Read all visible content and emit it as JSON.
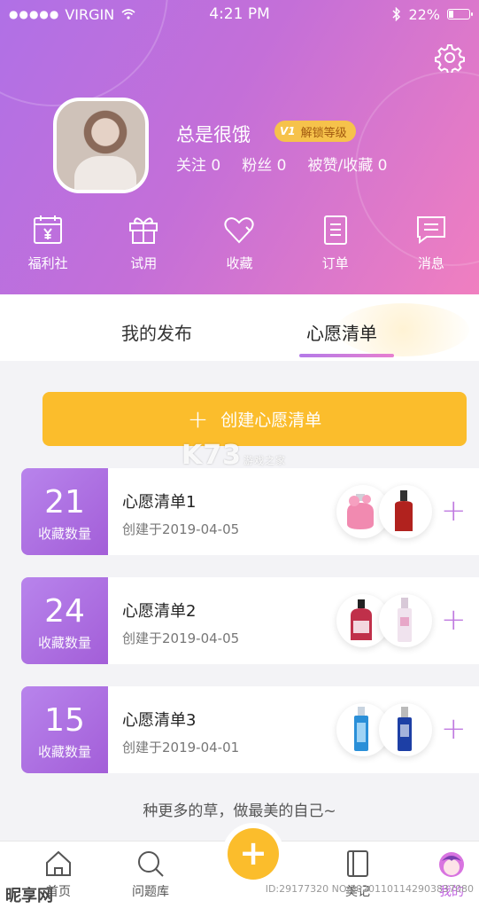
{
  "status": {
    "carrier": "VIRGIN",
    "signal": "●●●●●",
    "time": "4:21 PM",
    "battery": "22%"
  },
  "profile": {
    "name": "总是很饿",
    "level_badge": "V1",
    "unlock": "解锁等级",
    "following": "关注 0",
    "fans": "粉丝 0",
    "likes": "被赞/收藏 0"
  },
  "quick_links": [
    {
      "label": "福利社",
      "icon": "calendar-yen-icon"
    },
    {
      "label": "试用",
      "icon": "gift-icon"
    },
    {
      "label": "收藏",
      "icon": "heart-icon"
    },
    {
      "label": "订单",
      "icon": "clipboard-icon"
    },
    {
      "label": "消息",
      "icon": "chat-icon"
    }
  ],
  "tabs": [
    {
      "label": "我的发布"
    },
    {
      "label": "心愿清单",
      "active": true
    }
  ],
  "create_button": {
    "plus": "+",
    "label": "创建心愿清单"
  },
  "watermark": {
    "brand": "K73",
    "sub": "游戏之家"
  },
  "wishlists": [
    {
      "count": "21",
      "count_label": "收藏数量",
      "title": "心愿清单1",
      "date": "创建于2019-04-05"
    },
    {
      "count": "24",
      "count_label": "收藏数量",
      "title": "心愿清单2",
      "date": "创建于2019-04-05"
    },
    {
      "count": "15",
      "count_label": "收藏数量",
      "title": "心愿清单3",
      "date": "创建于2019-04-01"
    }
  ],
  "add_symbol": "+",
  "tagline": "种更多的草，做最美的自己~",
  "bottom_nav": [
    {
      "label": "首页",
      "icon": "home-icon"
    },
    {
      "label": "问题库",
      "icon": "search-icon"
    },
    {
      "label": "美记",
      "icon": "notebook-icon"
    },
    {
      "label": "我的",
      "icon": "profile-icon",
      "active": true
    }
  ],
  "fab": "+",
  "bottom_watermark": {
    "logo": "昵享网",
    "id": "ID:29177320 NO:20201101142903837080"
  },
  "colors": {
    "accent_purple": "#b070e6",
    "accent_pink": "#f07fc0",
    "yellow": "#fbbd2c"
  }
}
